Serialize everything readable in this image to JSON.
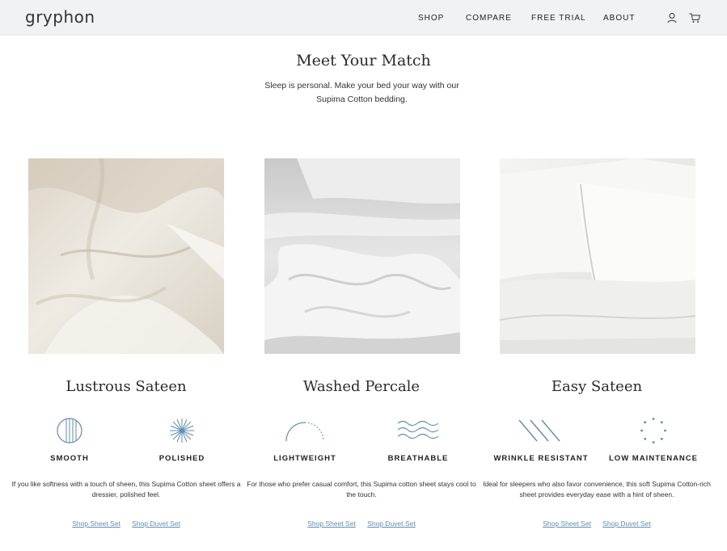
{
  "header": {
    "logo": "gryphon",
    "nav": [
      "SHOP",
      "COMPARE",
      "FREE TRIAL",
      "ABOUT"
    ],
    "icons": [
      "user-icon",
      "cart-icon"
    ]
  },
  "intro": {
    "title": "Meet Your Match",
    "subtitle": "Sleep is personal. Make your bed your way with our Supima Cotton bedding."
  },
  "products": [
    {
      "title": "Lustrous Sateen",
      "features": [
        {
          "label": "SMOOTH",
          "icon": "smooth-icon"
        },
        {
          "label": "POLISHED",
          "icon": "polished-icon"
        }
      ],
      "description": "If you like softness with a touch of sheen, this Supima Cotton sheet offers a dressier, polished feel.",
      "links": [
        "Shop Sheet Set",
        "Shop Duvet Set"
      ]
    },
    {
      "title": "Washed Percale",
      "features": [
        {
          "label": "LIGHTWEIGHT",
          "icon": "lightweight-icon"
        },
        {
          "label": "BREATHABLE",
          "icon": "breathable-icon"
        }
      ],
      "description": "For those who prefer casual comfort, this Supima cotton sheet stays cool to the touch.",
      "links": [
        "Shop Sheet Set",
        "Shop Duvet Set"
      ]
    },
    {
      "title": "Easy Sateen",
      "features": [
        {
          "label": "WRINKLE RESISTANT",
          "icon": "wrinkle-resistant-icon"
        },
        {
          "label": "LOW MAINTENANCE",
          "icon": "low-maintenance-icon"
        }
      ],
      "description": "Ideal for sleepers who also favor convenience, this soft Supima Cotton-rich sheet provides everyday ease with a hint of sheen.",
      "links": [
        "Shop Sheet Set",
        "Shop Duvet Set"
      ]
    }
  ],
  "colors": {
    "header_bg": "#f0f2f6",
    "icon_blue": "#5d8fb1",
    "link_blue": "#5d8fb1"
  }
}
